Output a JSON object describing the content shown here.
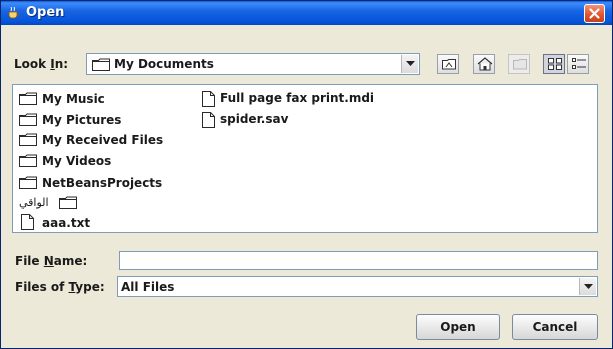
{
  "window": {
    "title": "Open"
  },
  "look_in": {
    "label_prefix": "Look ",
    "label_mnemonic": "I",
    "label_suffix": "n:",
    "value": "My Documents"
  },
  "files": [
    {
      "name": "My Music",
      "kind": "folder"
    },
    {
      "name": "My Pictures",
      "kind": "folder"
    },
    {
      "name": "My Received Files",
      "kind": "folder"
    },
    {
      "name": "My Videos",
      "kind": "folder"
    },
    {
      "name": "NetBeansProjects",
      "kind": "folder"
    },
    {
      "name": "الواقي",
      "kind": "folder"
    },
    {
      "name": "aaa.txt",
      "kind": "file"
    },
    {
      "name": "Full page fax print.mdi",
      "kind": "file"
    },
    {
      "name": "spider.sav",
      "kind": "file"
    }
  ],
  "file_name": {
    "label_prefix": "File ",
    "label_mnemonic": "N",
    "label_suffix": "ame:",
    "value": ""
  },
  "files_of_type": {
    "label_prefix": "Files of ",
    "label_mnemonic": "T",
    "label_suffix": "ype:",
    "value": "All Files"
  },
  "buttons": {
    "open": "Open",
    "cancel": "Cancel"
  },
  "icons": {
    "title": "java-cup-icon",
    "close": "close-icon",
    "up": "up-folder-icon",
    "home": "home-icon",
    "new_folder": "new-folder-icon",
    "list_view": "list-view-icon",
    "details_view": "details-view-icon",
    "folder": "folder-icon",
    "file": "file-icon",
    "dropdown": "chevron-down-icon"
  },
  "colors": {
    "titlebar": "#0553d8",
    "close": "#e4572f",
    "dialog_bg": "#ece9d8"
  }
}
